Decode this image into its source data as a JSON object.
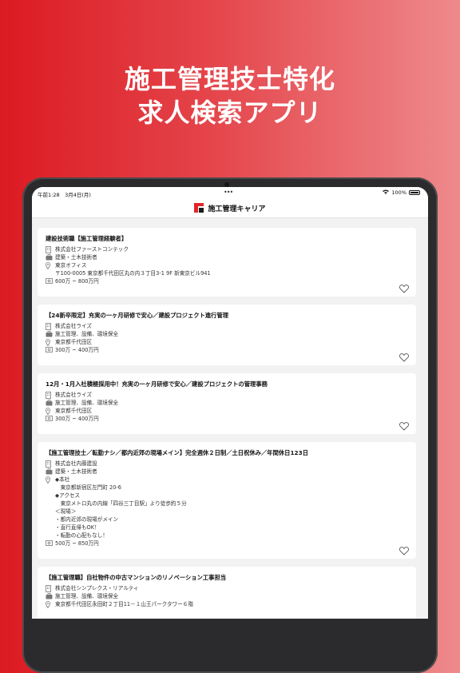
{
  "headline": {
    "line1": "施工管理技士特化",
    "line2": "求人検索アプリ"
  },
  "status_bar": {
    "time": "午前1:28　3月4日(月)",
    "battery": "100%"
  },
  "app": {
    "title": "施工管理キャリア",
    "brand_color": "#e0262c"
  },
  "jobs": [
    {
      "title": "建設技術職【施工管理経験者】",
      "company": "株式会社ファーストコンテック",
      "category": "建築・土木技術者",
      "location": [
        "東京オフィス",
        "〒100-0005 東京都千代田区丸の内３丁目3-1 9F 新東京ビル941"
      ],
      "salary": "600万 ~ 800万円"
    },
    {
      "title": "【24新卒限定】充実の一ヶ月研修で安心／建設プロジェクト進行管理",
      "company": "株式会社ライズ",
      "category": "施工管理、設備、環境保全",
      "location": [
        "東京都千代田区"
      ],
      "salary": "300万 ~ 400万円"
    },
    {
      "title": "12月・1月入社積極採用中！充実の一ヶ月研修で安心／建設プロジェクトの管理事務",
      "company": "株式会社ライズ",
      "category": "施工管理、設備、環境保全",
      "location": [
        "東京都千代田区"
      ],
      "salary": "300万 ~ 400万円"
    },
    {
      "title": "【施工管理技士／転勤ナシ／都内近郊の現場メイン】完全週休２日制／土日祝休み／年間休日123日",
      "company": "株式会社内藤建設",
      "category": "建築・土木技術者",
      "location": [
        "◆本社",
        "　東京都新宿区左門町 20-6",
        "◆アクセス",
        "　東京メトロ丸の内線「四谷三丁目駅」より徒歩約５分",
        "＜現場＞",
        "・都内近郊の現場がメイン",
        "・直行直帰もOK！",
        "・転勤の心配もなし！"
      ],
      "salary": "500万 ~ 850万円"
    },
    {
      "title": "【施工管理職】自社物件の中古マンションのリノベーション工事担当",
      "company": "株式会社シンプレクス・リアルティ",
      "category": "施工管理、設備、環境保全",
      "location": [
        "東京都千代田区永田町２丁目11－１山王パークタワー６階"
      ],
      "salary": ""
    }
  ]
}
